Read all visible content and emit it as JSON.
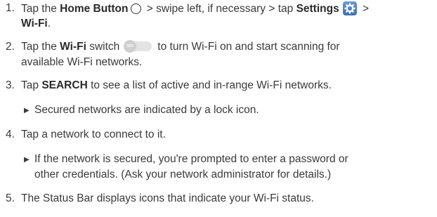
{
  "steps": [
    {
      "number": "1.",
      "pre": "Tap the ",
      "home_label": "Home Button",
      "mid": " > swipe left, if necessary > tap ",
      "settings_label": "Settings",
      "after_icon": " >",
      "line2_bold": "Wi-Fi",
      "line2_tail": "."
    },
    {
      "number": "2.",
      "pre": "Tap the ",
      "bold": "Wi-Fi",
      "mid": " switch",
      "toggle_text": "OFF",
      "tail": "to turn Wi-Fi on and start scanning for",
      "line2": "available Wi-Fi networks."
    },
    {
      "number": "3.",
      "pre": "Tap ",
      "bold": "SEARCH",
      "tail": " to see a list of active and in-range Wi-Fi networks.",
      "bullet": "Secured networks are indicated by a lock icon."
    },
    {
      "number": "4.",
      "text": "Tap a network to connect to it.",
      "bullet_line1": "If the network is secured, you're prompted to enter a password or",
      "bullet_line2": "other credentials. (Ask your network administrator for details.)"
    },
    {
      "number": "5.",
      "text": "The Status Bar displays icons that indicate your Wi-Fi status."
    }
  ],
  "bullet_glyph": "▶",
  "icons": {
    "home": "home-button-circle-icon",
    "settings": "settings-gear-icon",
    "switch": "wifi-toggle-switch-icon"
  }
}
